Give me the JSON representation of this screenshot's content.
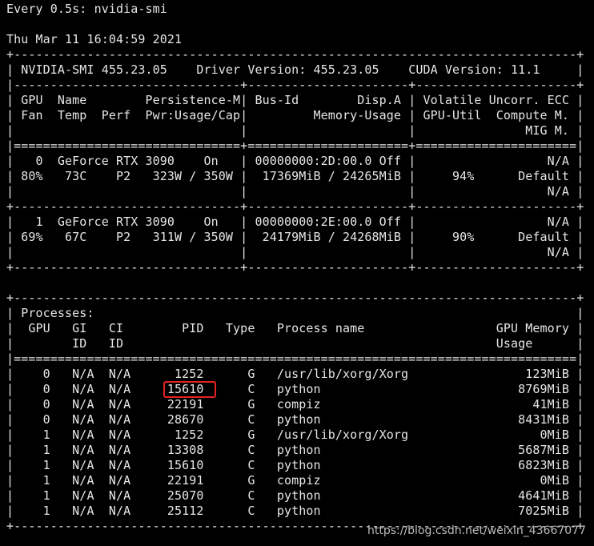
{
  "app": {
    "title": "Every 0.5s: nvidia-smi"
  },
  "timestamp": "Thu Mar 11 16:04:59 2021",
  "smi": {
    "border": "+-----------------------------------------------------------------------------+",
    "version_line": "| NVIDIA-SMI 455.23.05    Driver Version: 455.23.05    CUDA Version: 11.1     |",
    "gpu_table_sep": "|-------------------------------+----------------------+----------------------+",
    "gpu_header": [
      "| GPU  Name        Persistence-M| Bus-Id        Disp.A | Volatile Uncorr. ECC |",
      "| Fan  Temp  Perf  Pwr:Usage/Cap|         Memory-Usage | GPU-Util  Compute M. |",
      "|                               |                      |               MIG M. |"
    ],
    "double_sep": "|===============================+======================+======================|",
    "gpu_row_sep": "+-------------------------------+----------------------+----------------------+",
    "gpus": [
      {
        "lines": [
          "|   0  GeForce RTX 3090    On   | 00000000:2D:00.0 Off |                  N/A |",
          "| 80%   73C    P2   323W / 350W |  17369MiB / 24265MiB |     94%      Default |",
          "|                               |                      |                  N/A |"
        ]
      },
      {
        "lines": [
          "|   1  GeForce RTX 3090    On   | 00000000:2E:00.0 Off |                  N/A |",
          "| 69%   67C    P2   311W / 350W |  24179MiB / 24268MiB |     90%      Default |",
          "|                               |                      |                  N/A |"
        ]
      }
    ],
    "proc_border": "+-----------------------------------------------------------------------------+",
    "proc_title": "| Processes:                                                                  |",
    "proc_header": [
      "|  GPU   GI   CI        PID   Type   Process name                  GPU Memory |",
      "|        ID   ID                                                   Usage      |"
    ],
    "proc_double_sep": "|=============================================================================|",
    "processes": [
      "|    0   N/A  N/A      1252      G   /usr/lib/xorg/Xorg                123MiB |",
      "|    0   N/A  N/A     15610      C   python                           8769MiB |",
      "|    0   N/A  N/A     22191      G   compiz                             41MiB |",
      "|    0   N/A  N/A     28670      C   python                           8431MiB |",
      "|    1   N/A  N/A      1252      G   /usr/lib/xorg/Xorg                  0MiB |",
      "|    1   N/A  N/A     13308      C   python                           5687MiB |",
      "|    1   N/A  N/A     15610      C   python                           6823MiB |",
      "|    1   N/A  N/A     22191      G   compiz                              0MiB |",
      "|    1   N/A  N/A     25070      C   python                           4641MiB |",
      "|    1   N/A  N/A     25112      C   python                           7025MiB |"
    ],
    "proc_footer": "+-----------------------------------------------------------------------------+"
  },
  "watermark": "https://blog.csdn.net/weixin_43667077",
  "colors": {
    "background": "#000000",
    "text": "#e6e6e6",
    "highlight": "#e52222"
  }
}
